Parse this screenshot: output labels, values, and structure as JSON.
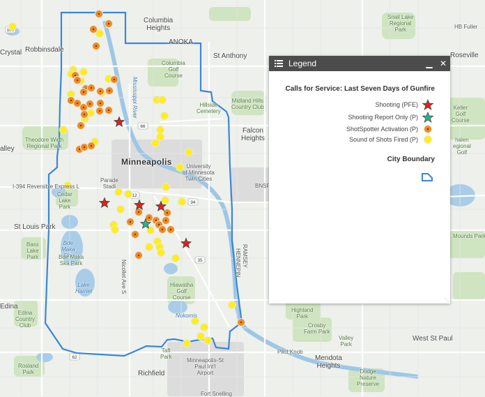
{
  "map": {
    "place_labels": [
      {
        "id": "columbia-heights",
        "text": "Columbia\nHeights",
        "cls": "big"
      },
      {
        "id": "anoka",
        "text": "ANOKA",
        "cls": "big"
      },
      {
        "id": "st-anthony",
        "text": "St Anthony",
        "cls": "big"
      },
      {
        "id": "crystal",
        "text": "Crystal",
        "cls": "big"
      },
      {
        "id": "robbinsdale",
        "text": "Robbinsdale",
        "cls": "big"
      },
      {
        "id": "snail-lake",
        "text": "Snail Lake\nRegional\nPark",
        "cls": "park"
      },
      {
        "id": "hb-fuller",
        "text": "HB Fuller",
        "cls": ""
      },
      {
        "id": "columbia-golf",
        "text": "Columbia\nGolf\nCourse",
        "cls": "park"
      },
      {
        "id": "mississippi-river",
        "text": "Mississippi River",
        "cls": "water vert"
      },
      {
        "id": "hillside-cemetery",
        "text": "Hillside\nCemetery",
        "cls": "park"
      },
      {
        "id": "midland-hills",
        "text": "Midland Hills\nCountry Club",
        "cls": "park"
      },
      {
        "id": "falcon-heights",
        "text": "Falcon\nHeights",
        "cls": "big"
      },
      {
        "id": "roseville",
        "text": "Roseville",
        "cls": "big"
      },
      {
        "id": "theodore-wirth",
        "text": "Theodore Wirth\nRegional Park",
        "cls": "park"
      },
      {
        "id": "valley",
        "text": "alley",
        "cls": "big"
      },
      {
        "id": "minneapolis",
        "text": "Minneapolis",
        "cls": "city"
      },
      {
        "id": "university",
        "text": "University\nof Minnesota\nTwin Cities",
        "cls": ""
      },
      {
        "id": "keller-golf",
        "text": "Keller\nGolf\nCourse",
        "cls": "park"
      },
      {
        "id": "phalen",
        "text": "halen\negional\nGolf",
        "cls": "park"
      },
      {
        "id": "i394",
        "text": "I-394 Reversible Express L",
        "cls": "road"
      },
      {
        "id": "parade",
        "text": "Parade\nStadi",
        "cls": ""
      },
      {
        "id": "cedar-lake",
        "text": "Cedar\nLake\nPark",
        "cls": "park"
      },
      {
        "id": "bnsf",
        "text": "BNSF",
        "cls": "road"
      },
      {
        "id": "st-louis-park",
        "text": "St Louis Park",
        "cls": "big"
      },
      {
        "id": "bass-lake",
        "text": "Bass\nLake\nPark",
        "cls": "park"
      },
      {
        "id": "bde-maka-ska",
        "text": "Bde\nMaka\nSka",
        "cls": "water"
      },
      {
        "id": "bde-maka-ska-park",
        "text": "Bde Maka\nSka Park",
        "cls": "park"
      },
      {
        "id": "mounds-park",
        "text": "Mounds Park",
        "cls": "park"
      },
      {
        "id": "lake-harriet",
        "text": "Lake\nHarriet",
        "cls": "water"
      },
      {
        "id": "nicollet-ave",
        "text": "Nicollet Ave S",
        "cls": "road vert"
      },
      {
        "id": "hiawatha-golf",
        "text": "Hiawatha\nGolf\nCourse",
        "cls": "park"
      },
      {
        "id": "ramsey",
        "text": "RAMSEY",
        "cls": "road vert"
      },
      {
        "id": "hennepin",
        "text": "HENNEPIN",
        "cls": "road vert"
      },
      {
        "id": "highland-park",
        "text": "Highland\nPark",
        "cls": "park"
      },
      {
        "id": "crosby-farm",
        "text": "Crosby\nFarm Park",
        "cls": "park"
      },
      {
        "id": "edina",
        "text": "Edina",
        "cls": "big"
      },
      {
        "id": "edina-cc",
        "text": "Edina\nCountry\nClub",
        "cls": "park"
      },
      {
        "id": "west-st-paul",
        "text": "West St Paul",
        "cls": "big"
      },
      {
        "id": "valley-park",
        "text": "Valley\nPark",
        "cls": "park"
      },
      {
        "id": "pilot-knob",
        "text": "Pilot Knob",
        "cls": ""
      },
      {
        "id": "mendota-heights",
        "text": "Mendota\nHeights",
        "cls": "big"
      },
      {
        "id": "dodge-nature",
        "text": "Dodge\nNature\nPreserve",
        "cls": "park"
      },
      {
        "id": "rosland-park",
        "text": "Rosland\nPark",
        "cls": "park"
      },
      {
        "id": "richfield",
        "text": "Richfield",
        "cls": "big"
      },
      {
        "id": "msp-airport",
        "text": "Minneapolis-St\nPaul Int'l\nAirport",
        "cls": ""
      },
      {
        "id": "fort-snelling",
        "text": "Fort Snelling",
        "cls": ""
      },
      {
        "id": "taft-park",
        "text": "Taft\nPark",
        "cls": "park"
      },
      {
        "id": "lake-nokomis-label",
        "text": "Nokomis",
        "cls": "water"
      }
    ],
    "route_shields": [
      {
        "id": "route-100",
        "text": "100"
      },
      {
        "id": "route-66",
        "text": "66"
      },
      {
        "id": "route-12",
        "text": "12"
      },
      {
        "id": "route-94",
        "text": "94"
      },
      {
        "id": "route-62",
        "text": "62"
      },
      {
        "id": "route-35",
        "text": "35"
      }
    ],
    "incidents": {
      "shooting_count": 5,
      "shooting_report_only_count": 1,
      "shotspotter_count": 36,
      "sound_of_shots_count": 42
    }
  },
  "legend": {
    "title": "Legend",
    "minimize_glyph": "▁",
    "close_glyph": "✕",
    "layer_title": "Calls for Service: Last Seven Days of Gunfire",
    "items": [
      {
        "label": "Shooting (PFE)",
        "symbol": "star-red"
      },
      {
        "label": "Shooting Report Only (P)",
        "symbol": "star-teal"
      },
      {
        "label": "ShotSpotter Activation (P)",
        "symbol": "orange-dot"
      },
      {
        "label": "Sound of Shots Fired (P)",
        "symbol": "yellow-dot"
      }
    ],
    "boundary_title": "City Boundary",
    "colors": {
      "shooting": "#d9231f",
      "report_only": "#27b38f",
      "shotspotter": "#f28a1c",
      "sound": "#ffee1a",
      "boundary": "#3a86d9"
    }
  }
}
